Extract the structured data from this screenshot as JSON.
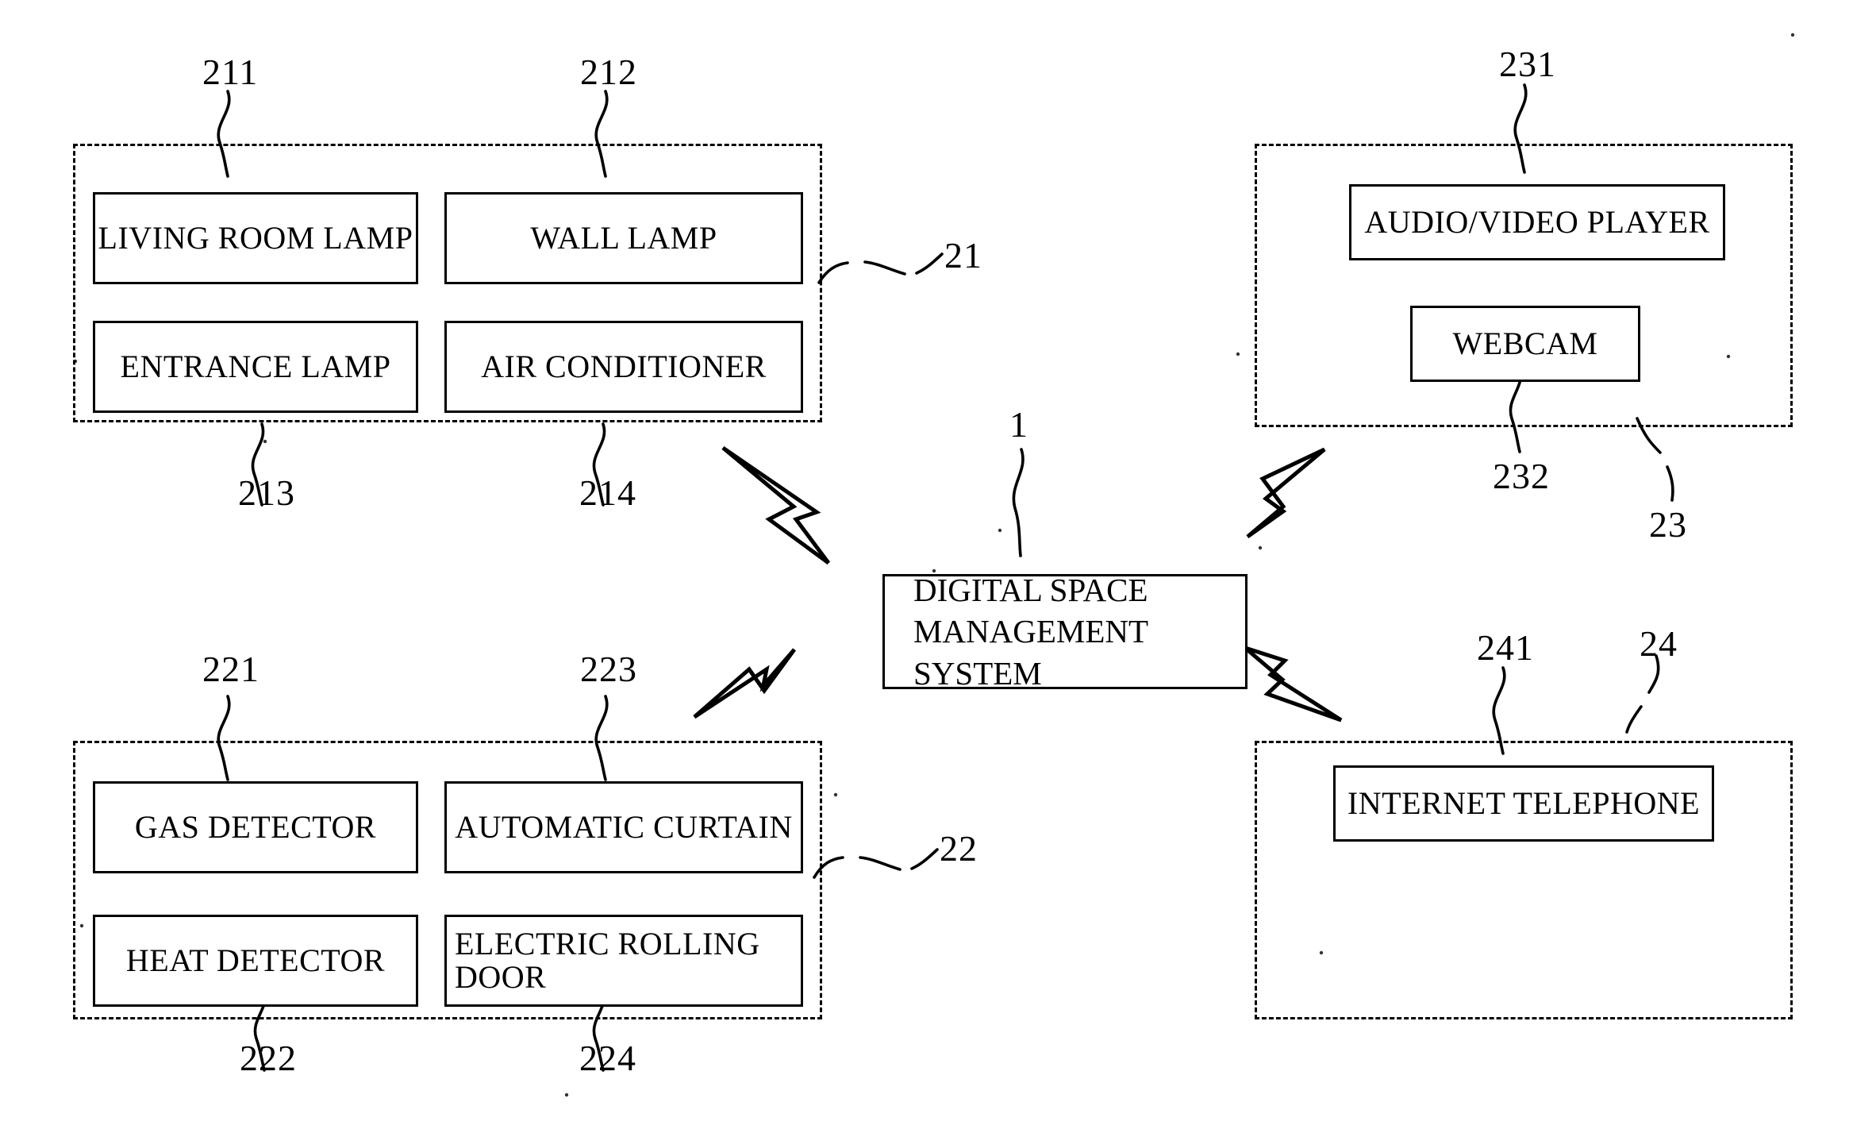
{
  "diagram": {
    "title": "Digital Space Management System Block Diagram",
    "figure_type": "patent-block-diagram",
    "line_color": "#000000",
    "background_color": "#ffffff"
  },
  "center": {
    "label": "DIGITAL SPACE\nMANAGEMENT SYSTEM",
    "ref": "1"
  },
  "groups": [
    {
      "id": "group-21",
      "ref": "21",
      "position": "top-left",
      "items": [
        {
          "label": "LIVING ROOM LAMP",
          "ref": "211",
          "ref_position": "above"
        },
        {
          "label": "WALL LAMP",
          "ref": "212",
          "ref_position": "above"
        },
        {
          "label": "ENTRANCE LAMP",
          "ref": "213",
          "ref_position": "below"
        },
        {
          "label": "AIR CONDITIONER",
          "ref": "214",
          "ref_position": "below"
        }
      ]
    },
    {
      "id": "group-22",
      "ref": "22",
      "position": "bottom-left",
      "items": [
        {
          "label": "GAS DETECTOR",
          "ref": "221",
          "ref_position": "above"
        },
        {
          "label": "AUTOMATIC CURTAIN",
          "ref": "223",
          "ref_position": "above"
        },
        {
          "label": "HEAT DETECTOR",
          "ref": "222",
          "ref_position": "below"
        },
        {
          "label": "ELECTRIC ROLLING\nDOOR",
          "ref": "224",
          "ref_position": "below"
        }
      ]
    },
    {
      "id": "group-23",
      "ref": "23",
      "position": "top-right",
      "items": [
        {
          "label": "AUDIO/VIDEO PLAYER",
          "ref": "231",
          "ref_position": "above"
        },
        {
          "label": "WEBCAM",
          "ref": "232",
          "ref_position": "below"
        }
      ]
    },
    {
      "id": "group-24",
      "ref": "24",
      "position": "bottom-right",
      "items": [
        {
          "label": "INTERNET TELEPHONE",
          "ref": "241",
          "ref_position": "above"
        }
      ]
    }
  ],
  "connectors": [
    {
      "name": "wireless-link-top-left",
      "icon": "lightning-bolt-icon",
      "direction": "up-left"
    },
    {
      "name": "wireless-link-top-right",
      "icon": "lightning-bolt-icon",
      "direction": "up-right"
    },
    {
      "name": "wireless-link-bottom-left",
      "icon": "lightning-bolt-icon",
      "direction": "down-left"
    },
    {
      "name": "wireless-link-bottom-right",
      "icon": "lightning-bolt-icon",
      "direction": "down-right"
    }
  ],
  "labels": {
    "ref_211": "211",
    "ref_212": "212",
    "ref_213": "213",
    "ref_214": "214",
    "ref_21": "21",
    "ref_221": "221",
    "ref_222": "222",
    "ref_223": "223",
    "ref_224": "224",
    "ref_22": "22",
    "ref_231": "231",
    "ref_232": "232",
    "ref_23": "23",
    "ref_241": "241",
    "ref_24": "24",
    "ref_1": "1"
  },
  "boxes": {
    "living_room_lamp": "LIVING ROOM LAMP",
    "wall_lamp": "WALL LAMP",
    "entrance_lamp": "ENTRANCE LAMP",
    "air_conditioner": "AIR CONDITIONER",
    "gas_detector": "GAS DETECTOR",
    "automatic_curtain": "AUTOMATIC CURTAIN",
    "heat_detector": "HEAT DETECTOR",
    "electric_rolling_door": "ELECTRIC ROLLING\nDOOR",
    "audio_video_player": "AUDIO/VIDEO PLAYER",
    "webcam": "WEBCAM",
    "internet_telephone": "INTERNET TELEPHONE",
    "digital_space_management_system": "DIGITAL SPACE\nMANAGEMENT SYSTEM"
  }
}
